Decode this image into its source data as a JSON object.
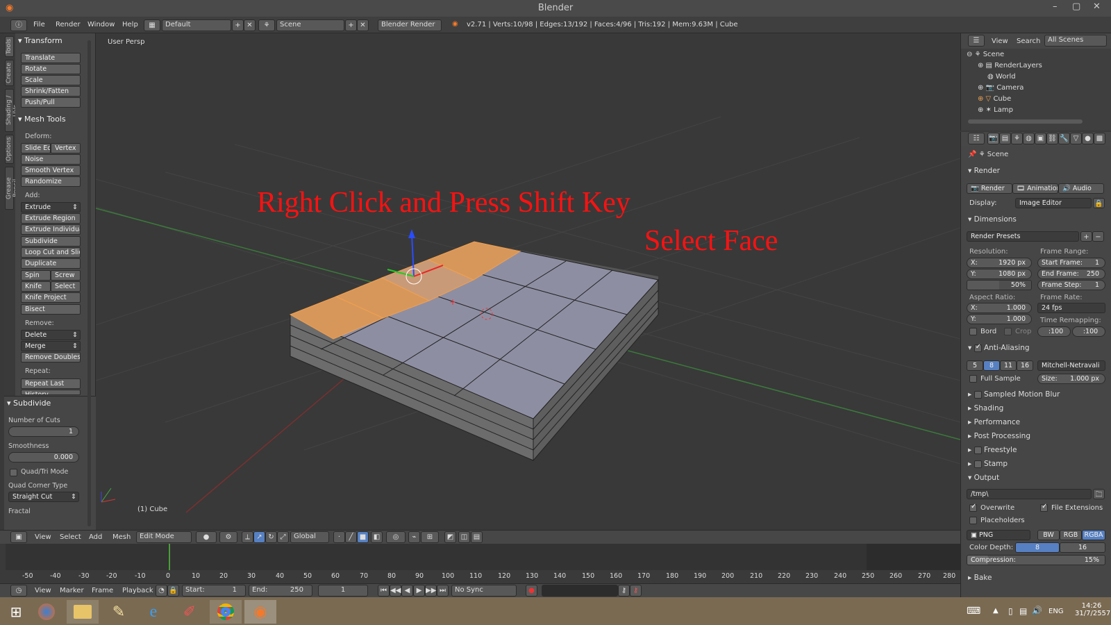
{
  "window": {
    "title": "Blender",
    "controls": [
      "–",
      "▢",
      "✕"
    ]
  },
  "infobar": {
    "menus": [
      "File",
      "Render",
      "Window",
      "Help"
    ],
    "layout": "Default",
    "scene": "Scene",
    "engine": "Blender Render",
    "stats": "v2.71 | Verts:10/98 | Edges:13/192 | Faces:4/96 | Tris:192 | Mem:9.63M | Cube"
  },
  "left_tabs": [
    "Tools",
    "Create",
    "Shading / UVs",
    "Options",
    "Grease Pencil"
  ],
  "toolshelf": {
    "transform_header": "Transform",
    "transform": [
      "Translate",
      "Rotate",
      "Scale",
      "Shrink/Fatten",
      "Push/Pull"
    ],
    "mesh_tools_header": "Mesh Tools",
    "deform_label": "Deform:",
    "deform_pair": [
      "Slide Ed",
      "Vertex"
    ],
    "deform": [
      "Noise",
      "Smooth Vertex",
      "Randomize"
    ],
    "add_label": "Add:",
    "extrude": "Extrude",
    "add": [
      "Extrude Region",
      "Extrude Individual",
      "Subdivide",
      "Loop Cut and Slide",
      "Duplicate"
    ],
    "spin_pair": [
      "Spin",
      "Screw"
    ],
    "knife_pair": [
      "Knife",
      "Select"
    ],
    "add2": [
      "Knife Project",
      "Bisect"
    ],
    "remove_label": "Remove:",
    "delete": "Delete",
    "merge": "Merge",
    "remove_doubles": "Remove Doubles",
    "repeat_label": "Repeat:",
    "repeat_last": "Repeat Last",
    "history": "History"
  },
  "operator": {
    "header": "Subdivide",
    "cuts_label": "Number of Cuts",
    "cuts_value": "1",
    "smooth_label": "Smoothness",
    "smooth_value": "0.000",
    "quad_tri": "Quad/Tri Mode",
    "corner_label": "Quad Corner Type",
    "corner_value": "Straight Cut",
    "fractal_label": "Fractal"
  },
  "viewport": {
    "label": "User Persp",
    "object_label": "(1) Cube",
    "annotation1": "Right Click and Press Shift Key",
    "annotation2": "Select Face",
    "annotation_color": "#ff1111"
  },
  "view3d_header": {
    "menus": [
      "View",
      "Select",
      "Add",
      "Mesh"
    ],
    "mode": "Edit Mode",
    "orientation": "Global"
  },
  "timeline": {
    "ticks": [
      "-50",
      "-40",
      "-30",
      "-20",
      "-10",
      "0",
      "10",
      "20",
      "30",
      "40",
      "50",
      "60",
      "70",
      "80",
      "90",
      "100",
      "110",
      "120",
      "130",
      "140",
      "150",
      "160",
      "170",
      "180",
      "190",
      "200",
      "210",
      "220",
      "230",
      "240",
      "250",
      "260",
      "270",
      "280"
    ],
    "menus": [
      "View",
      "Marker",
      "Frame",
      "Playback"
    ],
    "start": "Start:",
    "start_value": "1",
    "end": "End:",
    "end_value": "250",
    "current": "1",
    "sync": "No Sync"
  },
  "outliner": {
    "menus": [
      "View",
      "Search"
    ],
    "filter": "All Scenes",
    "items": [
      "Scene",
      "RenderLayers",
      "World",
      "Camera",
      "Cube",
      "Lamp"
    ]
  },
  "properties": {
    "context": "Scene",
    "render_header": "Render",
    "render_buttons": [
      "Render",
      "Animation",
      "Audio"
    ],
    "display_label": "Display:",
    "display_value": "Image Editor",
    "dimensions_header": "Dimensions",
    "presets": "Render Presets",
    "resolution_label": "Resolution:",
    "res_x": "X:",
    "res_x_val": "1920 px",
    "res_y": "Y:",
    "res_y_val": "1080 px",
    "res_pct": "50%",
    "frame_range_label": "Frame Range:",
    "start_frame": "Start Frame:",
    "start_frame_val": "1",
    "end_frame": "End Frame:",
    "end_frame_val": "250",
    "frame_step": "Frame Step:",
    "frame_step_val": "1",
    "aspect_label": "Aspect Ratio:",
    "asp_x": "X:",
    "asp_x_val": "1.000",
    "asp_y": "Y:",
    "asp_y_val": "1.000",
    "frame_rate_label": "Frame Rate:",
    "fps": "24 fps",
    "time_remap_label": "Time Remapping:",
    "remap_old": ":100",
    "remap_new": ":100",
    "bord": "Bord",
    "crop": "Crop",
    "aa_header": "Anti-Aliasing",
    "aa_samples": [
      "5",
      "8",
      "11",
      "16"
    ],
    "aa_filter": "Mitchell-Netravali",
    "full_sample": "Full Sample",
    "size_label": "Size:",
    "size_val": "1.000 px",
    "collapsed": [
      "Sampled Motion Blur",
      "Shading",
      "Performance",
      "Post Processing",
      "Freestyle",
      "Stamp"
    ],
    "output_header": "Output",
    "output_path": "/tmp\\",
    "overwrite": "Overwrite",
    "file_ext": "File Extensions",
    "placeholders": "Placeholders",
    "format": "PNG",
    "color_modes": [
      "BW",
      "RGB",
      "RGBA"
    ],
    "color_depth_label": "Color Depth:",
    "depths": [
      "8",
      "16"
    ],
    "compression_label": "Compression:",
    "compression_val": "15%",
    "bake_header": "Bake"
  },
  "taskbar": {
    "lang": "ENG",
    "time": "14:26",
    "date": "31/7/2557"
  }
}
